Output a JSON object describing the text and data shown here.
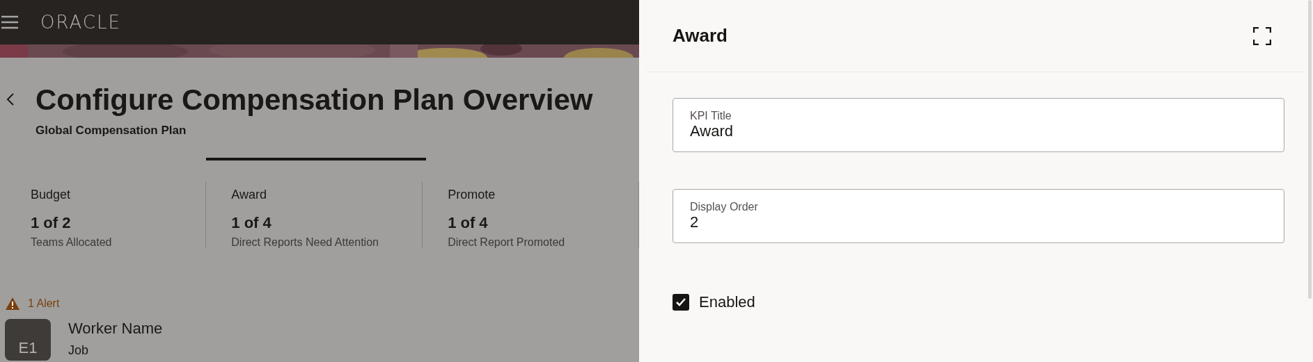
{
  "header": {
    "logo": "ORACLE"
  },
  "page": {
    "title": "Configure Compensation Plan Overview",
    "subtitle": "Global Compensation Plan"
  },
  "metrics": [
    {
      "label": "Budget",
      "value": "1 of 2",
      "caption": "Teams Allocated",
      "selected": false
    },
    {
      "label": "Award",
      "value": "1 of 4",
      "caption": "Direct Reports Need Attention",
      "selected": true
    },
    {
      "label": "Promote",
      "value": "1 of 4",
      "caption": "Direct Report Promoted",
      "selected": false
    }
  ],
  "alert": {
    "text": "1 Alert"
  },
  "worker": {
    "initials": "E1",
    "name": "Worker Name",
    "job": "Job"
  },
  "drawer": {
    "title": "Award",
    "fields": [
      {
        "label": "KPI Title",
        "value": "Award"
      },
      {
        "label": "Display Order",
        "value": "2"
      }
    ],
    "checkbox": {
      "label": "Enabled",
      "checked": true
    }
  }
}
